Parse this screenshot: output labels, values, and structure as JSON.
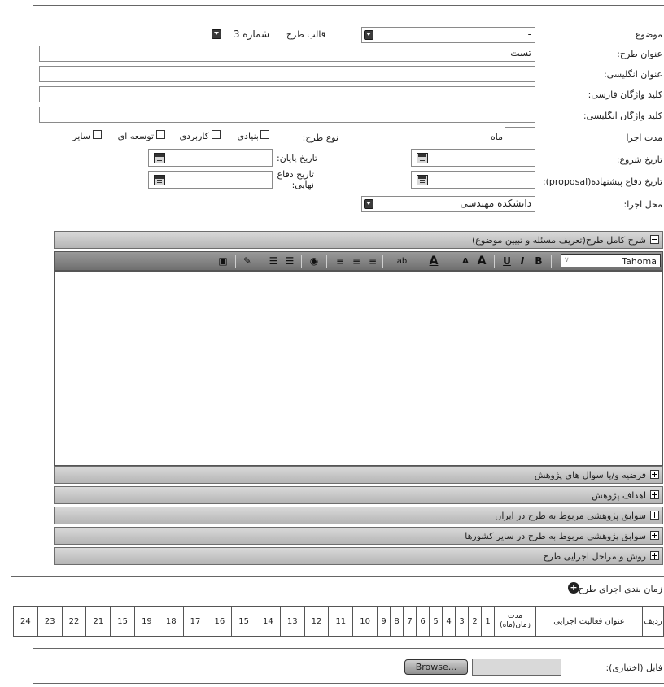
{
  "form": {
    "subject_label": "موضوع",
    "subject_value": "-",
    "template_label": "قالب طرح",
    "template_value": "شماره 3",
    "title_fa_label": "عنوان طرح:",
    "title_fa_value": "تست",
    "title_en_label": "عنوان انگلیسی:",
    "keywords_fa_label": "کلید واژگان فارسی:",
    "keywords_en_label": "کلید واژگان انگلیسی:",
    "duration_label": "مدت اجرا",
    "duration_unit": "ماه",
    "type_label": "نوع طرح:",
    "type_options": [
      "بنیادی",
      "کاربردی",
      "توسعه ای",
      "سایر"
    ],
    "start_date_label": "تاریخ شروع:",
    "end_date_label": "تاریخ پایان:",
    "proposal_defense_label": "تاریخ دفاع پیشنهاده(proposal):",
    "final_defense_label_1": "تاریخ دفاع",
    "final_defense_label_2": "نهایی:",
    "location_label": "محل اجرا:",
    "location_value": "دانشکده مهندسی"
  },
  "editor": {
    "panel_title": "شرح کامل طرح(تعریف مسئله و تبیین موضوع)",
    "font_value": "Tahoma",
    "bold": "B",
    "italic": "I",
    "underline": "U",
    "grow": "A",
    "shrink": "A",
    "font_color": "A",
    "spell": "ab"
  },
  "sections": [
    "فرضیه و/یا سوال های پژوهش",
    "اهداف پژوهش",
    "سوابق پژوهشی مربوط به طرح در ایران",
    "سوابق پژوهشی مربوط به طرح در سایر کشورها",
    "روش و مراحل اجرایی طرح"
  ],
  "schedule": {
    "title": "زمان بندی اجرای طرح",
    "col_row": "ردیف",
    "col_activity": "عنوان فعالیت اجرایی",
    "col_duration_1": "مدت",
    "col_duration_2": "زمان(ماه)",
    "months": [
      "1",
      "2",
      "3",
      "4",
      "5",
      "6",
      "7",
      "8",
      "9",
      "10",
      "11",
      "12",
      "13",
      "14",
      "15",
      "16",
      "17",
      "18",
      "19",
      "15",
      "21",
      "22",
      "23",
      "24"
    ]
  },
  "file": {
    "label": "فایل (اختیاری):",
    "browse_label": "Browse..."
  }
}
